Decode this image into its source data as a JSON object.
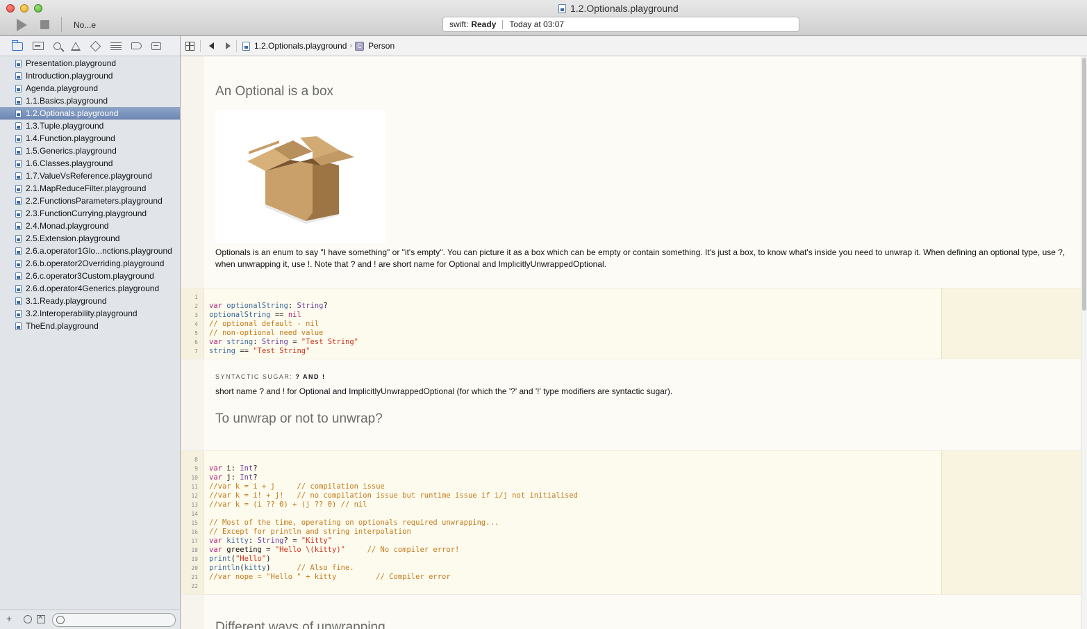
{
  "window": {
    "title": "1.2.Optionals.playground",
    "scheme": "No...e",
    "status_prefix": "swift:",
    "status_state": "Ready",
    "status_time": "Today at 03:07"
  },
  "sidebar": {
    "files": [
      "Presentation.playground",
      "Introduction.playground",
      "Agenda.playground",
      "1.1.Basics.playground",
      "1.2.Optionals.playground",
      "1.3.Tuple.playground",
      "1.4.Function.playground",
      "1.5.Generics.playground",
      "1.6.Classes.playground",
      "1.7.ValueVsReference.playground",
      "2.1.MapReduceFilter.playground",
      "2.2.FunctionsParameters.playground",
      "2.3.FunctionCurrying.playground",
      "2.4.Monad.playground",
      "2.5.Extension.playground",
      "2.6.a.operator1Glo...nctions.playground",
      "2.6.b.operator2Overriding.playground",
      "2.6.c.operator3Custom.playground",
      "2.6.d.operator4Generics.playground",
      "3.1.Ready.playground",
      "3.2.Interoperability.playground",
      "TheEnd.playground"
    ],
    "selected_index": 4,
    "add_label": "+"
  },
  "jumpbar": {
    "file": "1.2.Optionals.playground",
    "separator": "›",
    "symbol_icon": "C",
    "symbol": "Person"
  },
  "editor": {
    "heading1": "An Optional is a box",
    "paragraph1": "Optionals is an enum to say \"I have something\" or \"it's empty\". You can picture it as a box which can be empty or contain something. It's just a box, to know what's inside you need to unwrap it. When defining an optional type, use ?, when unwrapping it, use !. Note that ? and ! are short name for Optional and ImplicitlyUnwrappedOptional.",
    "subheading_prefix": "SYNTACTIC SUGAR:",
    "subheading_symbols": "? AND !",
    "paragraph2": "short name ? and ! for Optional and ImplicitlyUnwrappedOptional (for which the '?' and '!' type modifiers are syntactic sugar).",
    "heading2": "To unwrap or not to unwrap?",
    "heading3": "Different ways of unwrapping",
    "code_block1": {
      "line_numbers": [
        "1",
        "2",
        "3",
        "4",
        "5",
        "6",
        "7"
      ],
      "lines": [
        "",
        "var optionalString: String?",
        "optionalString == nil",
        "// optional default - nil",
        "// non-optional need value",
        "var string: String = \"Test String\"",
        "string == \"Test String\""
      ]
    },
    "code_block2": {
      "line_numbers": [
        "8",
        "9",
        "10",
        "11",
        "12",
        "13",
        "14",
        "15",
        "16",
        "17",
        "18",
        "19",
        "20",
        "21",
        "22"
      ],
      "lines": [
        "",
        "var i: Int?",
        "var j: Int?",
        "//var k = i + j     // compilation issue",
        "//var k = i! + j!   // no compilation issue but runtime issue if i/j not initialised",
        "//var k = (i ?? 0) + (j ?? 0) // nil",
        "",
        "// Most of the time, operating on optionals required unwrapping...",
        "// Except for println and string interpolation",
        "var kitty: String? = \"Kitty\"",
        "var greeting = \"Hello \\(kitty)\"     // No compiler error!",
        "print(\"Hello\")",
        "println(kitty)      // Also fine.",
        "//var nope = \"Hello \" + kitty         // Compiler error",
        ""
      ]
    }
  },
  "colors": {
    "keyword": "#b0237e",
    "type": "#6f42a3",
    "comment": "#c47a1c",
    "string": "#d12f1b",
    "identifier": "#3e6aa0",
    "selection": "#7a91bd"
  }
}
